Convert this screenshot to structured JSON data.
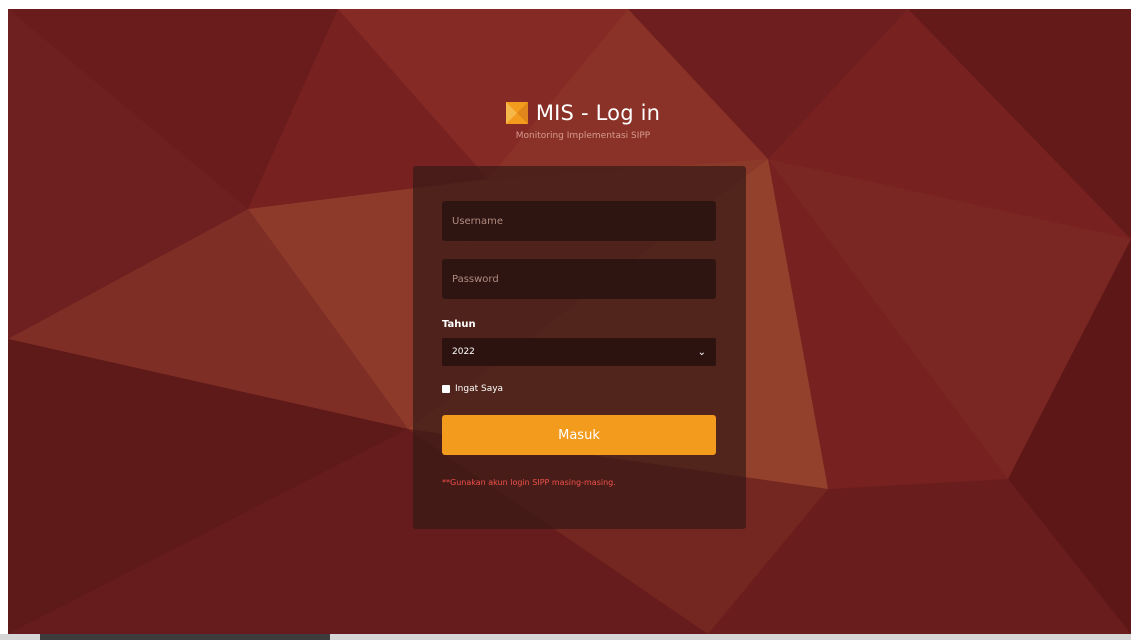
{
  "header": {
    "title": "MIS - Log in",
    "subtitle": "Monitoring Implementasi SIPP",
    "logo_icon": "mis-logo-icon"
  },
  "form": {
    "username_placeholder": "Username",
    "username_value": "",
    "password_placeholder": "Password",
    "password_value": "",
    "year_label": "Tahun",
    "year_selected": "2022",
    "year_chevron_icon": "chevron-down-icon",
    "remember_label": "Ingat Saya",
    "remember_checked": false,
    "submit_label": "Masuk",
    "note": "**Gunakan akun login SIPP masing-masing."
  },
  "colors": {
    "background": "#7a2222",
    "accent": "#f29b1d",
    "note": "#f0504a"
  }
}
